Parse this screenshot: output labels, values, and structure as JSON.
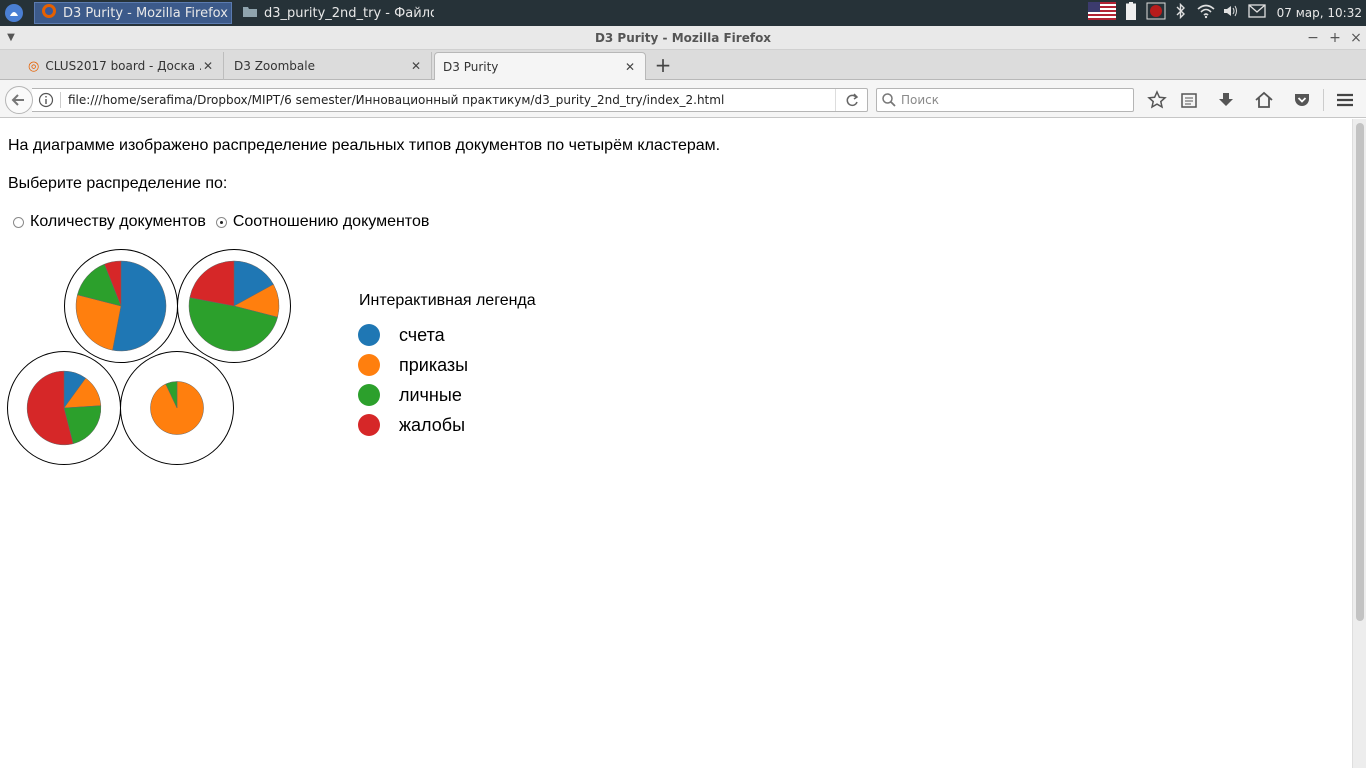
{
  "taskbar": {
    "tasks": [
      {
        "label": "D3 Purity - Mozilla Firefox",
        "icon": "firefox-icon"
      },
      {
        "label": "d3_purity_2nd_try - Файлов...",
        "icon": "folder-icon"
      }
    ],
    "clock": "07 мар, 10:32"
  },
  "window": {
    "title": "D3 Purity - Mozilla Firefox"
  },
  "tabs": [
    {
      "label": "CLUS2017 board - Доска ...",
      "icon": "tab-favicon-icon"
    },
    {
      "label": "D3 Zoombale"
    },
    {
      "label": "D3 Purity",
      "selected": true
    }
  ],
  "navbar": {
    "url": "file:///home/serafima/Dropbox/MIPT/6 semester/Инновационный практикум/d3_purity_2nd_try/index_2.html",
    "search_placeholder": "Поиск"
  },
  "page": {
    "intro": "На диаграмме изображено распределение реальных типов документов по четырём кластерам.",
    "choose_label": "Выберите распределение по:",
    "radio_options": [
      {
        "label": "Количеству документов",
        "checked": false
      },
      {
        "label": "Соотношению документов",
        "checked": true
      }
    ],
    "legend_title": "Интерактивная легенда"
  },
  "colors": {
    "счета": "#1f77b4",
    "приказы": "#ff7f0e",
    "личные": "#2ca02c",
    "жалобы": "#d62728"
  },
  "chart_data": {
    "type": "pie",
    "categories": [
      "счета",
      "приказы",
      "личные",
      "жалобы"
    ],
    "clusters": [
      {
        "values": [
          0.53,
          0.26,
          0.15,
          0.06
        ],
        "scale": 1.0
      },
      {
        "values": [
          0.17,
          0.12,
          0.49,
          0.22
        ],
        "scale": 1.0
      },
      {
        "values": [
          0.1,
          0.14,
          0.22,
          0.54
        ],
        "scale": 0.82
      },
      {
        "values": [
          0.0,
          0.93,
          0.07,
          0.0
        ],
        "scale": 0.59
      }
    ],
    "legend": [
      "счета",
      "приказы",
      "личные",
      "жалобы"
    ]
  }
}
